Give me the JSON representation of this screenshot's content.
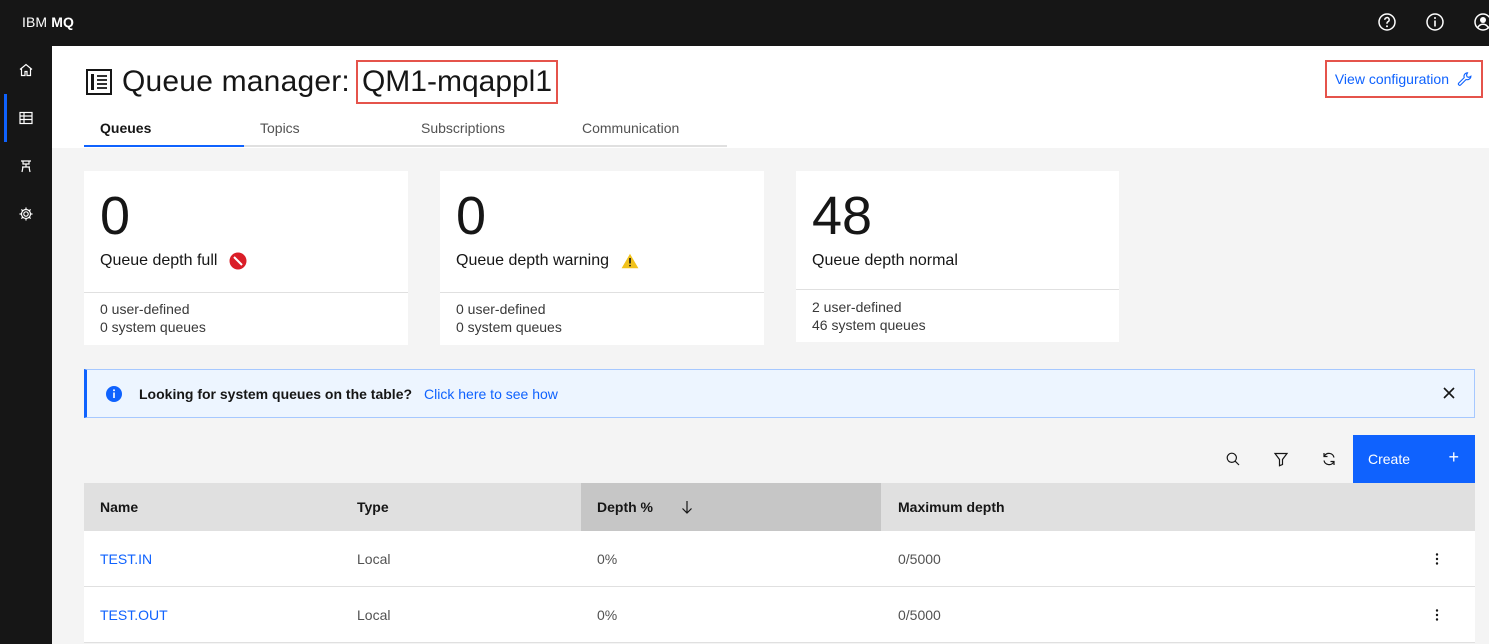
{
  "app": {
    "brand_prefix": "IBM ",
    "brand_product": "MQ"
  },
  "topbar": {
    "icons": [
      "help-icon",
      "info-icon",
      "user-icon"
    ]
  },
  "sidenav": {
    "items": [
      "home-icon",
      "table-icon",
      "flow-icon",
      "settings-icon"
    ]
  },
  "header": {
    "title_prefix": "Queue manager:",
    "queue_manager": "QM1-mqappl1",
    "view_configuration": "View configuration"
  },
  "tabs": [
    {
      "label": "Queues"
    },
    {
      "label": "Topics"
    },
    {
      "label": "Subscriptions"
    },
    {
      "label": "Communication"
    }
  ],
  "tiles": [
    {
      "value": "0",
      "label": "Queue depth full",
      "status_icon": "error-icon",
      "line1": "0  user-defined",
      "line2": "0  system queues"
    },
    {
      "value": "0",
      "label": "Queue depth warning",
      "status_icon": "warning-icon",
      "line1": "0  user-defined",
      "line2": "0  system queues"
    },
    {
      "value": "48",
      "label": "Queue depth normal",
      "status_icon": "",
      "line1": "2  user-defined",
      "line2": "46  system queues"
    }
  ],
  "banner": {
    "title": "Looking for system queues on the table?",
    "link": "Click here to see how"
  },
  "toolbar": {
    "create_label": "Create",
    "create_plus": "+"
  },
  "table": {
    "columns": [
      "Name",
      "Type",
      "Depth %",
      "Maximum depth"
    ],
    "sorted_column": "Depth %",
    "rows": [
      {
        "name": "TEST.IN",
        "type": "Local",
        "depth": "0%",
        "max_depth": "0/5000"
      },
      {
        "name": "TEST.OUT",
        "type": "Local",
        "depth": "0%",
        "max_depth": "0/5000"
      }
    ]
  },
  "colors": {
    "accent": "#0f62fe",
    "highlight": "#e5534b",
    "error": "#da1e28",
    "warning": "#f1c21b",
    "shell": "#161616"
  }
}
